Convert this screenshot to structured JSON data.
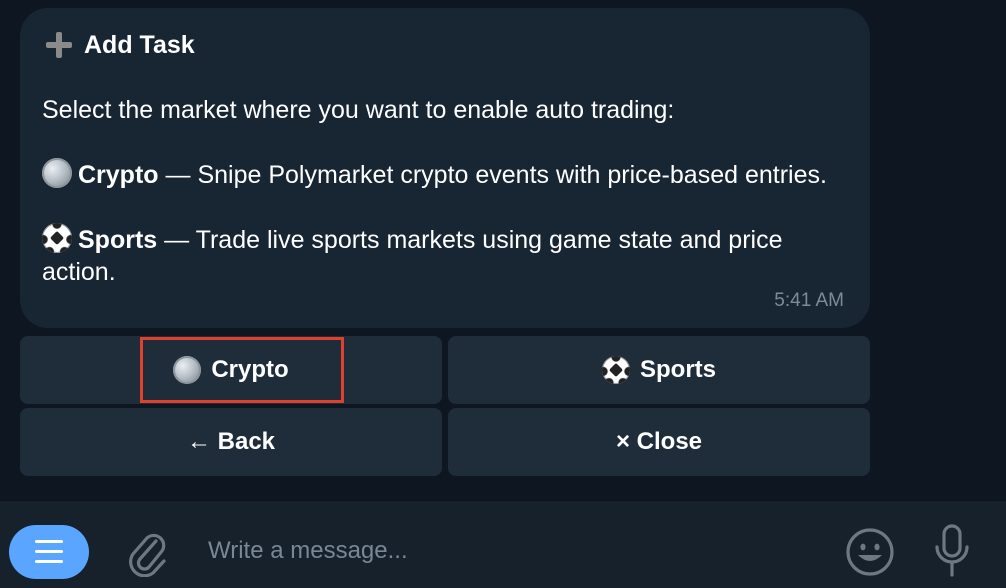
{
  "message": {
    "title": "Add Task",
    "prompt": "Select the market where you want to enable auto trading:",
    "markets": [
      {
        "name": "Crypto",
        "dash": " — ",
        "description": "Snipe Polymarket crypto events with price-based entries."
      },
      {
        "name": "Sports",
        "dash": " — ",
        "description": "Trade live sports markets using game state and price action."
      }
    ],
    "time": "5:41 AM"
  },
  "keyboard": {
    "crypto_label": "Crypto",
    "sports_label": "Sports",
    "back_label": "← Back",
    "close_label": "× Close"
  },
  "composer": {
    "placeholder": "Write a message..."
  },
  "colors": {
    "accent": "#5aa5ff",
    "highlight": "#e0412b",
    "bubble": "#182533",
    "button": "#1f2c3a"
  },
  "icons": [
    "plus-icon",
    "coin-icon",
    "soccer-ball-icon",
    "menu-icon",
    "paperclip-icon",
    "emoji-icon",
    "microphone-icon"
  ]
}
